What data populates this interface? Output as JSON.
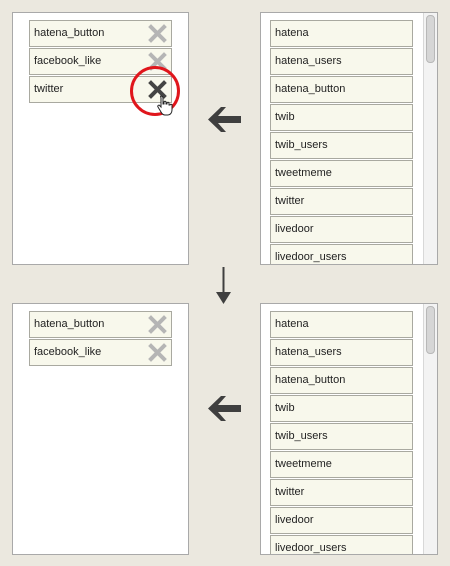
{
  "before": {
    "selected_items": [
      {
        "label": "hatena_button"
      },
      {
        "label": "facebook_like"
      },
      {
        "label": "twitter"
      }
    ],
    "available_items": [
      {
        "label": "hatena"
      },
      {
        "label": "hatena_users"
      },
      {
        "label": "hatena_button"
      },
      {
        "label": "twib"
      },
      {
        "label": "twib_users"
      },
      {
        "label": "tweetmeme"
      },
      {
        "label": "twitter"
      },
      {
        "label": "livedoor"
      },
      {
        "label": "livedoor_users"
      }
    ]
  },
  "after": {
    "selected_items": [
      {
        "label": "hatena_button"
      },
      {
        "label": "facebook_like"
      }
    ],
    "available_items": [
      {
        "label": "hatena"
      },
      {
        "label": "hatena_users"
      },
      {
        "label": "hatena_button"
      },
      {
        "label": "twib"
      },
      {
        "label": "twib_users"
      },
      {
        "label": "tweetmeme"
      },
      {
        "label": "twitter"
      },
      {
        "label": "livedoor"
      },
      {
        "label": "livedoor_users"
      }
    ]
  },
  "colors": {
    "background": "#ebe8df",
    "item_background": "#f8f8ec",
    "remove_icon_hover": "#444444",
    "remove_icon_normal": "#b5b5b5",
    "highlight_ring": "#e0161c",
    "arrow": "#3f3f3f"
  },
  "icons": {
    "remove": "close-x-icon",
    "move_left": "arrow-left-icon",
    "step_down": "arrow-down-icon",
    "cursor": "hand-pointer-icon"
  }
}
